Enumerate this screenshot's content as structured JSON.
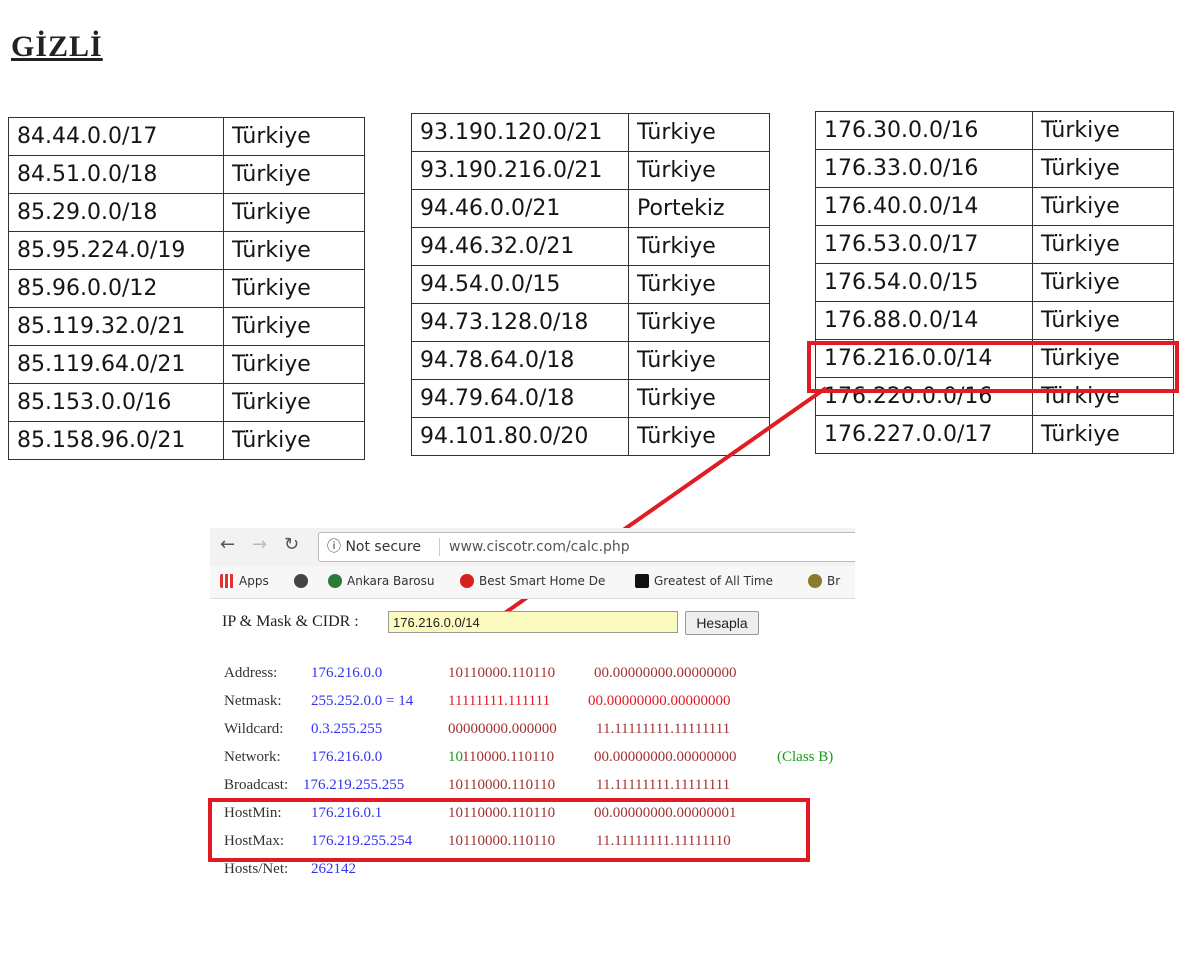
{
  "heading": "GİZLİ",
  "tables": [
    {
      "rows": [
        [
          "84.44.0.0/17",
          "Türkiye"
        ],
        [
          "84.51.0.0/18",
          "Türkiye"
        ],
        [
          "85.29.0.0/18",
          "Türkiye"
        ],
        [
          "85.95.224.0/19",
          "Türkiye"
        ],
        [
          "85.96.0.0/12",
          "Türkiye"
        ],
        [
          "85.119.32.0/21",
          "Türkiye"
        ],
        [
          "85.119.64.0/21",
          "Türkiye"
        ],
        [
          "85.153.0.0/16",
          "Türkiye"
        ],
        [
          "85.158.96.0/21",
          "Türkiye"
        ]
      ]
    },
    {
      "rows": [
        [
          "93.190.120.0/21",
          "Türkiye"
        ],
        [
          "93.190.216.0/21",
          "Türkiye"
        ],
        [
          "94.46.0.0/21",
          "Portekiz"
        ],
        [
          "94.46.32.0/21",
          "Türkiye"
        ],
        [
          "94.54.0.0/15",
          "Türkiye"
        ],
        [
          "94.73.128.0/18",
          "Türkiye"
        ],
        [
          "94.78.64.0/18",
          "Türkiye"
        ],
        [
          "94.79.64.0/18",
          "Türkiye"
        ],
        [
          "94.101.80.0/20",
          "Türkiye"
        ]
      ]
    },
    {
      "rows": [
        [
          "176.30.0.0/16",
          "Türkiye"
        ],
        [
          "176.33.0.0/16",
          "Türkiye"
        ],
        [
          "176.40.0.0/14",
          "Türkiye"
        ],
        [
          "176.53.0.0/17",
          "Türkiye"
        ],
        [
          "176.54.0.0/15",
          "Türkiye"
        ],
        [
          "176.88.0.0/14",
          "Türkiye"
        ],
        [
          "176.216.0.0/14",
          "Türkiye"
        ],
        [
          "176.220.0.0/16",
          "Türkiye"
        ],
        [
          "176.227.0.0/17",
          "Türkiye"
        ]
      ]
    }
  ],
  "browser": {
    "not_secure": "ⓘ Not secure",
    "url": "www.ciscotr.com/calc.php",
    "bookmarks": [
      "Apps",
      "Ankara Barosu",
      "Best Smart Home De",
      "Greatest of All Time",
      "Br"
    ]
  },
  "calc": {
    "label": "IP & Mask & CIDR :",
    "input_value": "176.216.0.0/14",
    "button": "Hesapla",
    "results": [
      {
        "label": "Address:",
        "value": "176.216.0.0",
        "bin_a": "10110000.110110",
        "bin_b": "00.00000000.00000000"
      },
      {
        "label": "Netmask:",
        "value": "255.252.0.0 = 14",
        "bin_a": "11111111.111111",
        "bin_b": "00.00000000.00000000"
      },
      {
        "label": "Wildcard:",
        "value": "0.3.255.255",
        "bin_a": "00000000.000000",
        "bin_b": "11.11111111.11111111"
      },
      {
        "label": "Network:",
        "value": "176.216.0.0",
        "bin_a_green": "10",
        "bin_a": "110000.110110",
        "bin_b": "00.00000000.00000000",
        "extra": "(Class B)"
      },
      {
        "label": "Broadcast:",
        "value": "176.219.255.255",
        "bin_a": "10110000.110110",
        "bin_b": "11.11111111.11111111"
      },
      {
        "label": "HostMin:",
        "value": "176.216.0.1",
        "bin_a": "10110000.110110",
        "bin_b": "00.00000000.00000001"
      },
      {
        "label": "HostMax:",
        "value": "176.219.255.254",
        "bin_a": "10110000.110110",
        "bin_b": "11.11111111.11111110"
      },
      {
        "label": "Hosts/Net:",
        "value": "262142"
      }
    ]
  },
  "colors": {
    "highlight": "#e01b24",
    "value_blue": "#3333ee",
    "binary_red": "#a03232",
    "class_green": "#1a9a1a"
  }
}
